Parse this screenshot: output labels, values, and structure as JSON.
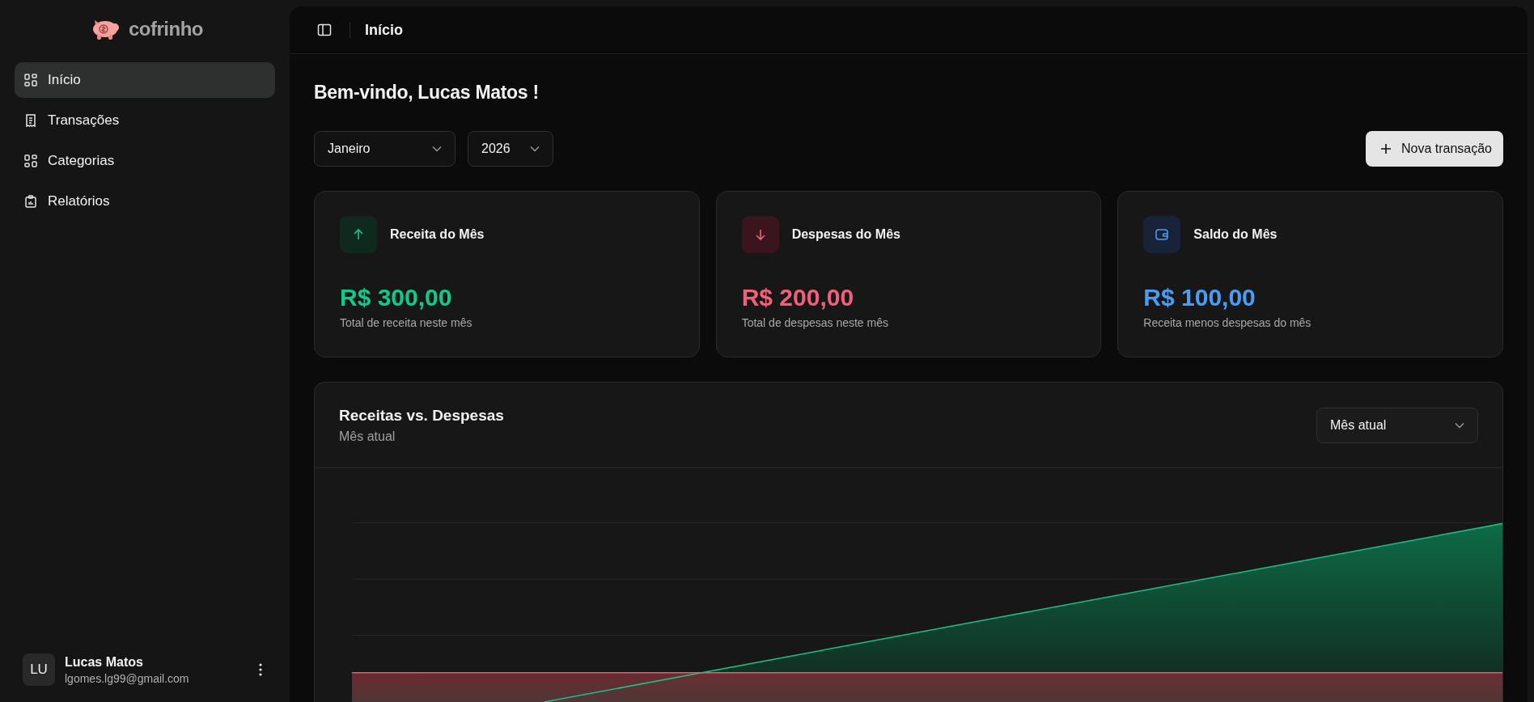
{
  "sidebar": {
    "brand": "cofrinho",
    "items": [
      {
        "label": "Início",
        "kind": "grid",
        "selected": true
      },
      {
        "label": "Transações",
        "kind": "receipt",
        "selected": false
      },
      {
        "label": "Categorias",
        "kind": "grid",
        "selected": false
      },
      {
        "label": "Relatórios",
        "kind": "clipboard",
        "selected": false
      }
    ],
    "user": {
      "initials": "LU",
      "name": "Lucas Matos",
      "email": "lgomes.lg99@gmail.com"
    }
  },
  "header": {
    "title": "Início"
  },
  "welcome": "Bem-vindo, Lucas Matos !",
  "filters": [
    {
      "value": "Janeiro"
    },
    {
      "value": "2026"
    }
  ],
  "new_button": "Nova transação",
  "cards": [
    {
      "kind": "income",
      "title": "Receita do Mês",
      "amount": "R$ 300,00",
      "caption": "Total de receita neste mês"
    },
    {
      "kind": "expense",
      "title": "Despesas do Mês",
      "amount": "R$ 200,00",
      "caption": "Total de despesas neste mês"
    },
    {
      "kind": "balance",
      "title": "Saldo do Mês",
      "amount": "R$ 100,00",
      "caption": "Receita menos despesas do mês"
    }
  ],
  "chart_card": {
    "title": "Receitas vs. Despesas",
    "subtitle": "Mês atual",
    "period": "Mês atual"
  }
}
